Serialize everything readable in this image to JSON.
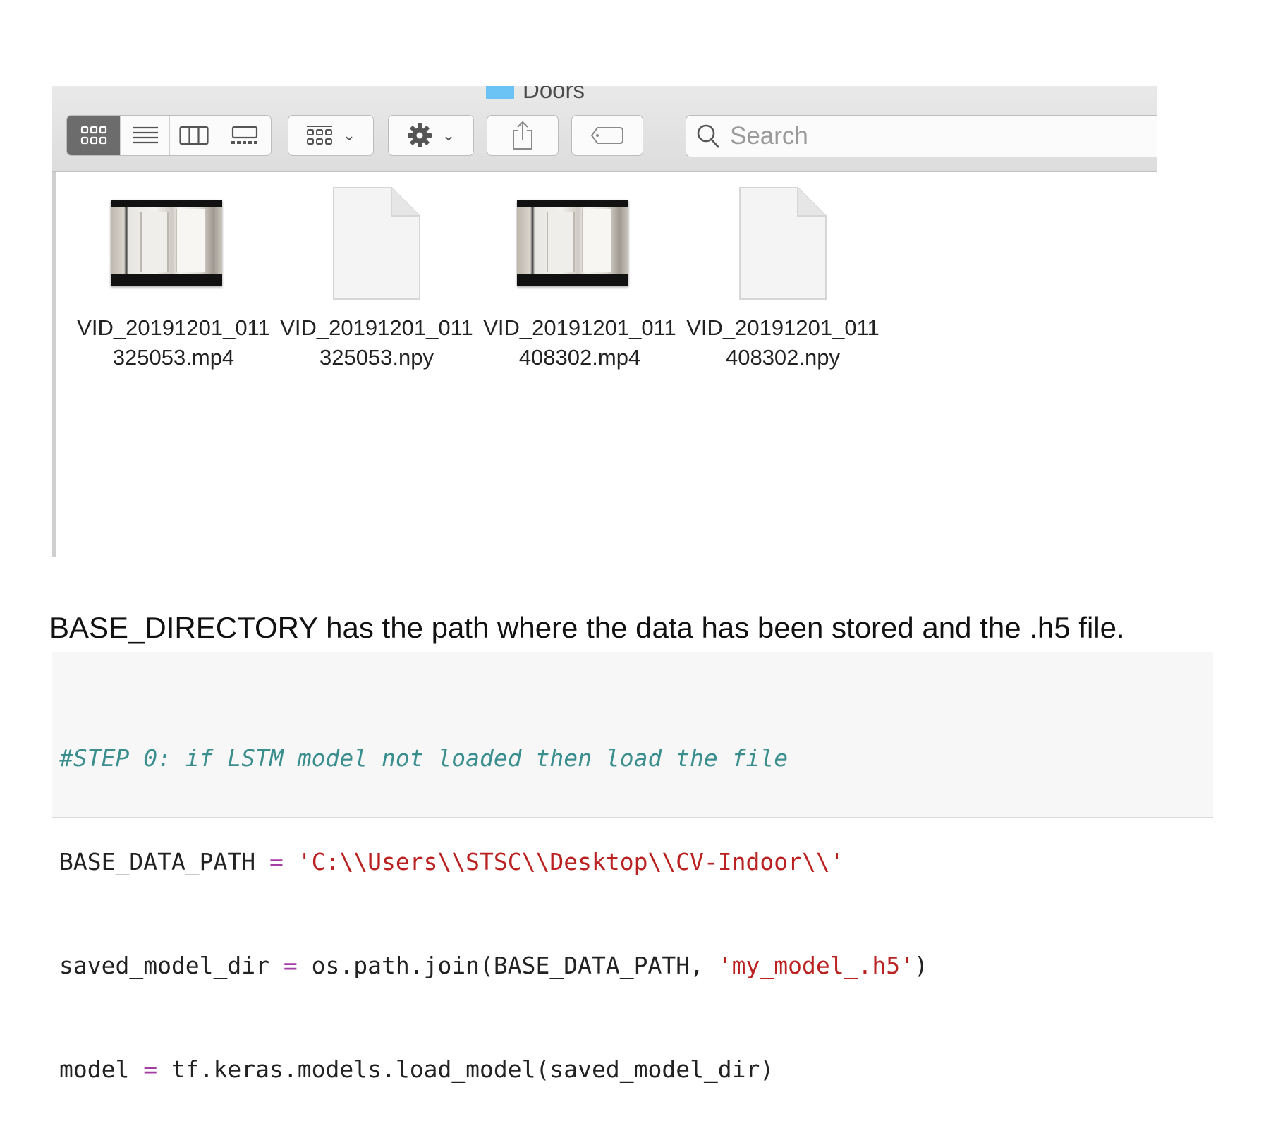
{
  "window": {
    "title": "Doors",
    "search_placeholder": "Search",
    "toolbar": {
      "view_modes": [
        "icon-view",
        "list-view",
        "column-view",
        "gallery-view"
      ],
      "active_view": "icon-view",
      "group_button": "group-by",
      "action_button": "action",
      "share_button": "share",
      "tag_button": "tags"
    }
  },
  "files": [
    {
      "line1": "VID_20191201_011",
      "line2": "325053.mp4",
      "kind": "video"
    },
    {
      "line1": "VID_20191201_011",
      "line2": "325053.npy",
      "kind": "document"
    },
    {
      "line1": "VID_20191201_011",
      "line2": "408302.mp4",
      "kind": "video"
    },
    {
      "line1": "VID_20191201_011",
      "line2": "408302.npy",
      "kind": "document"
    }
  ],
  "caption": "BASE_DIRECTORY has the path where the data has been stored and the .h5 file.",
  "code": {
    "line1_comment": "#STEP 0: if LSTM model not loaded then load the file",
    "line2_var": "BASE_DATA_PATH ",
    "line2_op": "=",
    "line2_str": " 'C:\\\\Users\\\\STSC\\\\Desktop\\\\CV-Indoor\\\\'",
    "line3_var": "saved_model_dir ",
    "line3_op": "=",
    "line3_mid": " os.path.join(BASE_DATA_PATH, ",
    "line3_str": "'my_model_.h5'",
    "line3_end": ")",
    "line4_var": "model ",
    "line4_op": "=",
    "line4_rest": " tf.keras.models.load_model(saved_model_dir)"
  },
  "colors": {
    "folder": "#6ac3f4",
    "active_segment": "#6c6c6c",
    "comment": "#3a8e8e",
    "string": "#ba2121",
    "operator": "#a33ea3"
  }
}
